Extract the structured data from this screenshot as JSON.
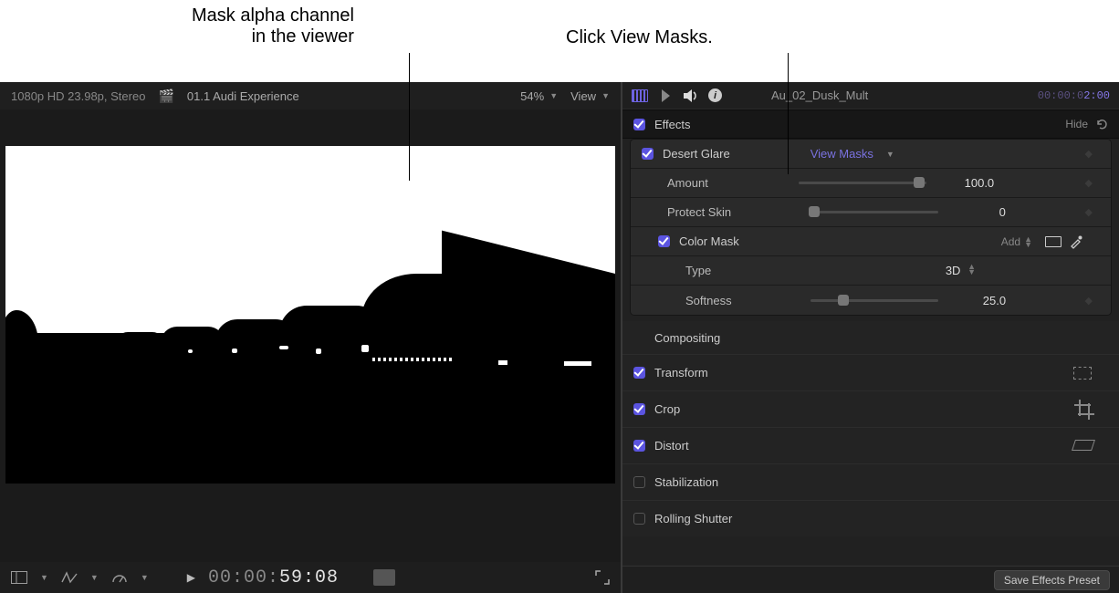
{
  "callouts": {
    "left_line1": "Mask alpha channel",
    "left_line2": "in the viewer",
    "right": "Click View Masks."
  },
  "viewer": {
    "format": "1080p HD 23.98p, Stereo",
    "project": "01.1 Audi Experience",
    "zoom": "54%",
    "view_label": "View",
    "timecode_prefix": "00:00:",
    "timecode_strong": "59:08"
  },
  "inspector": {
    "clip_name": "Au_02_Dusk_Mult",
    "timecode_dim": "00:00:0",
    "timecode_bright": "2:00",
    "effects_header": "Effects",
    "hide_label": "Hide",
    "effect_name": "Desert Glare",
    "view_masks": "View Masks",
    "params": {
      "amount_label": "Amount",
      "amount_value": "100.0",
      "protect_label": "Protect Skin",
      "protect_value": "0",
      "colormask_label": "Color Mask",
      "add_label": "Add",
      "type_label": "Type",
      "type_value": "3D",
      "softness_label": "Softness",
      "softness_value": "25.0"
    },
    "sections": {
      "compositing": "Compositing",
      "transform": "Transform",
      "crop": "Crop",
      "distort": "Distort",
      "stabilization": "Stabilization",
      "rolling": "Rolling Shutter"
    },
    "save_preset": "Save Effects Preset"
  }
}
